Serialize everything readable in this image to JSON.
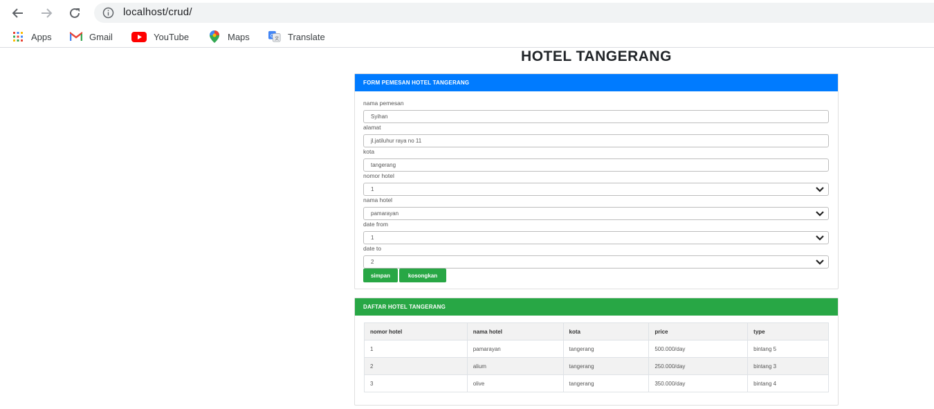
{
  "browser": {
    "url": "localhost/crud/",
    "bookmarks": [
      {
        "label": "Apps",
        "icon": "apps-grid-icon"
      },
      {
        "label": "Gmail",
        "icon": "gmail-icon"
      },
      {
        "label": "YouTube",
        "icon": "youtube-icon"
      },
      {
        "label": "Maps",
        "icon": "maps-icon"
      },
      {
        "label": "Translate",
        "icon": "translate-icon"
      }
    ]
  },
  "page": {
    "title": "HOTEL TANGERANG"
  },
  "form": {
    "header": "FORM PEMESAN HOTEL TANGERANG",
    "fields": {
      "nama_pemesan": {
        "label": "nama pemesan",
        "value": "Syihan"
      },
      "alamat": {
        "label": "alamat",
        "value": "jl.jatiluhur raya no 11"
      },
      "kota": {
        "label": "kota",
        "value": "tangerang"
      },
      "nomor_hotel": {
        "label": "nomor hotel",
        "value": "1"
      },
      "nama_hotel": {
        "label": "nama hotel",
        "value": "pamarayan"
      },
      "date_from": {
        "label": "date from",
        "value": "1"
      },
      "date_to": {
        "label": "date to",
        "value": "2"
      }
    },
    "buttons": {
      "save": "simpan",
      "clear": "kosongkan"
    }
  },
  "list": {
    "header": "DAFTAR HOTEL TANGERANG",
    "columns": [
      "nomor hotel",
      "nama hotel",
      "kota",
      "price",
      "type"
    ],
    "rows": [
      [
        "1",
        "pamarayan",
        "tangerang",
        "500.000/day",
        "bintang 5"
      ],
      [
        "2",
        "alium",
        "tangerang",
        "250.000/day",
        "bintang 3"
      ],
      [
        "3",
        "olive",
        "tangerang",
        "350.000/day",
        "bintang 4"
      ]
    ]
  },
  "colors": {
    "primary": "#007bff",
    "success": "#28a745"
  }
}
